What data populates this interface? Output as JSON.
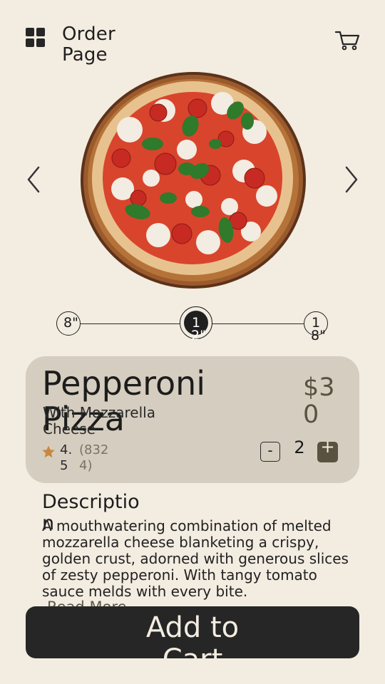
{
  "header": {
    "title": "Order Page",
    "menu_icon": "grid-icon",
    "cart_icon": "cart-icon"
  },
  "hero": {
    "image": "pepperoni-pizza-image",
    "prev_icon": "chevron-left-icon",
    "next_icon": "chevron-right-icon"
  },
  "sizes": [
    {
      "label": "8\"",
      "selected": false
    },
    {
      "label": "12\"",
      "selected": true
    },
    {
      "label": "18\"",
      "selected": false
    }
  ],
  "product": {
    "name": "Pepperoni Pizza",
    "subtitle": "With Mozzarella Cheese",
    "price": "$30",
    "rating": "4.5",
    "reviews": "(8324)",
    "quantity": "2",
    "minus_label": "-",
    "plus_label": "+"
  },
  "description": {
    "title": "Description",
    "body": "A mouthwatering combination of melted mozzarella cheese blanketing a crispy, golden crust, adorned with generous slices of zesty pepperoni. With tangy tomato sauce melds with every bite.",
    "read_more": "Read More"
  },
  "cta": {
    "label": "Add to Cart"
  },
  "colors": {
    "background": "#f3ece1",
    "card": "#d5cdbf",
    "accent": "#5a5240",
    "dark": "#262626",
    "star": "#c9873e"
  }
}
